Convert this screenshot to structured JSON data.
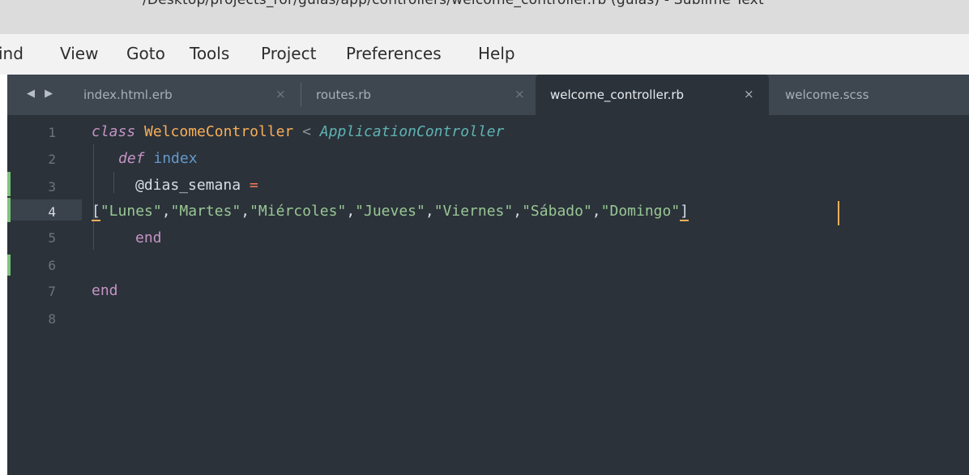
{
  "window": {
    "title": "/Desktop/projects_ror/guias/app/controllers/welcome_controller.rb (guias) - Sublime Text"
  },
  "menu": {
    "items": [
      "Find",
      "View",
      "Goto",
      "Tools",
      "Project",
      "Preferences",
      "Help"
    ],
    "first_item_visible": "ind"
  },
  "tabs": {
    "nav_arrows": "◀ ▶",
    "items": [
      {
        "label": "index.html.erb",
        "close": "×",
        "active": false
      },
      {
        "label": "routes.rb",
        "close": "×",
        "active": false
      },
      {
        "label": "welcome_controller.rb",
        "close": "×",
        "active": true
      },
      {
        "label": "welcome.scss",
        "close": "",
        "active": false
      }
    ]
  },
  "editor": {
    "line_numbers": [
      "1",
      "2",
      "3",
      "4",
      "5",
      "6",
      "7",
      "8"
    ],
    "current_line": "4",
    "modified_lines": [
      "3",
      "4",
      "6"
    ],
    "code": {
      "l1_class": "class",
      "l1_name": "WelcomeController",
      "l1_op": "<",
      "l1_super": "ApplicationController",
      "l2_def": "def",
      "l2_method": "index",
      "l3_ivar": "@dias_semana",
      "l3_assign": "=",
      "l4_open": "[",
      "l4_strings": [
        "\"Lunes\"",
        "\"Martes\"",
        "\"Miércoles\"",
        "\"Jueves\"",
        "\"Viernes\"",
        "\"Sábado\"",
        "\"Domingo\""
      ],
      "l4_comma": ",",
      "l4_close": "]",
      "l5_end": "end",
      "l7_end": "end"
    }
  },
  "colors": {
    "editor_bg": "#2b323a",
    "tabbar_bg": "#3e4650",
    "keyword": "#c594c5",
    "class_name": "#f9ae58",
    "string": "#99c794",
    "superclass": "#5fb3b3",
    "function": "#6699cc",
    "gutter_modified": "#7cc47c",
    "caret": "#f9ae58"
  }
}
